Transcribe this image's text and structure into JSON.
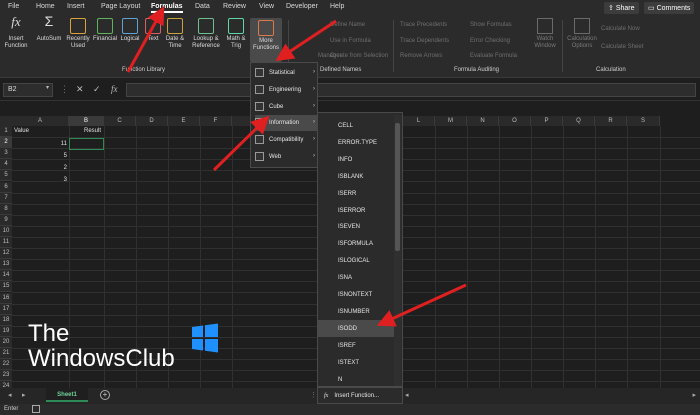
{
  "tabs": [
    "File",
    "Home",
    "Insert",
    "Page Layout",
    "Formulas",
    "Data",
    "Review",
    "View",
    "Developer",
    "Help"
  ],
  "active_tab": "Formulas",
  "top_buttons": {
    "share": "Share",
    "comments": "Comments"
  },
  "ribbon": {
    "insert_function": "Insert\nFunction",
    "autosum": "AutoSum",
    "recently_used": "Recently\nUsed",
    "financial": "Financial",
    "logical": "Logical",
    "text": "Text",
    "date_time": "Date &\nTime",
    "lookup_reference": "Lookup &\nReference",
    "math_trig": "Math &\nTrig",
    "more_functions": "More\nFunctions",
    "define_name": "Define Name",
    "use_in_formula": "Use in Formula",
    "create_from_selection": "Create from Selection",
    "name_manager": "Manager",
    "trace_precedents": "Trace Precedents",
    "trace_dependents": "Trace Dependents",
    "remove_arrows": "Remove Arrows",
    "show_formulas": "Show Formulas",
    "error_checking": "Error Checking",
    "evaluate_formula": "Evaluate Formula",
    "watch_window": "Watch\nWindow",
    "calc_options": "Calculation\nOptions",
    "calculate_now": "Calculate Now",
    "calculate_sheet": "Calculate Sheet",
    "groups": [
      "Function Library",
      "Defined Names",
      "Formula Auditing",
      "Calculation"
    ]
  },
  "formula_bar": {
    "name_box": "B2",
    "fx": "fx"
  },
  "columns": [
    "A",
    "B",
    "C",
    "D",
    "E",
    "F",
    "L",
    "M",
    "N",
    "O",
    "P",
    "Q",
    "R",
    "S"
  ],
  "rows": [
    "1",
    "2",
    "3",
    "4",
    "5",
    "6",
    "7",
    "8",
    "9",
    "10",
    "11",
    "12",
    "13",
    "14",
    "15",
    "16",
    "17",
    "18",
    "19",
    "20",
    "21",
    "22",
    "23",
    "24"
  ],
  "cells": {
    "a1": "Value",
    "b1": "Result",
    "a2": "11",
    "a3": "5",
    "a4": "2",
    "a5": "3"
  },
  "menu_more_functions": [
    "Statistical",
    "Engineering",
    "Cube",
    "Information",
    "Compatibility",
    "Web"
  ],
  "menu_information": [
    "CELL",
    "ERROR.TYPE",
    "INFO",
    "ISBLANK",
    "ISERR",
    "ISERROR",
    "ISEVEN",
    "ISFORMULA",
    "ISLOGICAL",
    "ISNA",
    "ISNONTEXT",
    "ISNUMBER",
    "ISODD",
    "ISREF",
    "ISTEXT",
    "N"
  ],
  "insert_function_link": "Insert Function...",
  "sheet_tab": "Sheet1",
  "status": "Enter",
  "watermark": {
    "line1": "The",
    "line2": "WindowsClub"
  },
  "colors": {
    "accent_green": "#2e8b57",
    "arrow_red": "#e02020",
    "win_blue": "#1e90ff"
  }
}
